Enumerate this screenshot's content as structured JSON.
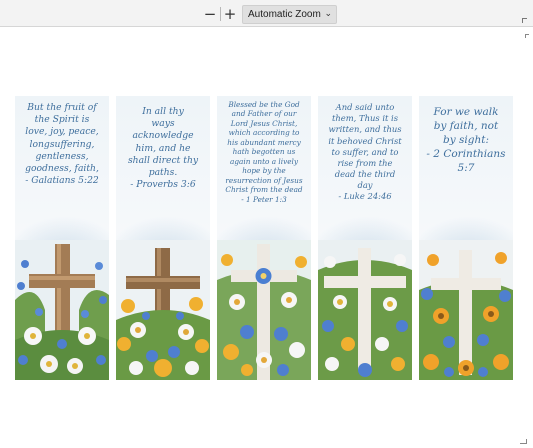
{
  "toolbar": {
    "zoom_out_icon": "minus-icon",
    "zoom_in_icon": "plus-icon",
    "zoom_select_value": "Automatic Zoom",
    "zoom_dropdown_icon": "chevron-down-icon"
  },
  "bookmarks": [
    {
      "verse": "But the fruit of\nthe Spirit is\nlove, joy, peace,\nlongsuffering,\ngentleness,\ngoodness, faith,\n- Galatians 5:22",
      "cross": "wood-dark",
      "flowers": "blue-white"
    },
    {
      "verse": "In all thy\nways\nacknowledge\nhim, and he\nshall direct thy\npaths.\n- Proverbs 3:6",
      "cross": "wood-light",
      "flowers": "yellow-blue-white"
    },
    {
      "verse": "Blessed be the God\nand Father of our\nLord Jesus Christ,\nwhich according to\nhis abundant mercy\nhath begotten us\nagain unto a lively\nhope by the\nresurrection of Jesus\nChrist from the dead\n- 1 Peter 1:3",
      "cross": "white-with-flower",
      "flowers": "mixed"
    },
    {
      "verse": "And said unto\nthem, Thus it is\nwritten, and thus\nit behoved Christ\nto suffer, and to\nrise from the\ndead the third\nday\n- Luke 24:46",
      "cross": "white",
      "flowers": "white-blue-yellow"
    },
    {
      "verse": "For we walk\nby faith, not\nby sight:\n- 2 Corinthians\n5:7",
      "cross": "white",
      "flowers": "orange-blue"
    }
  ],
  "colors": {
    "verse_text": "#3f6f9d",
    "toolbar_bg": "#f3f3f3",
    "page_bg": "#ffffff"
  }
}
